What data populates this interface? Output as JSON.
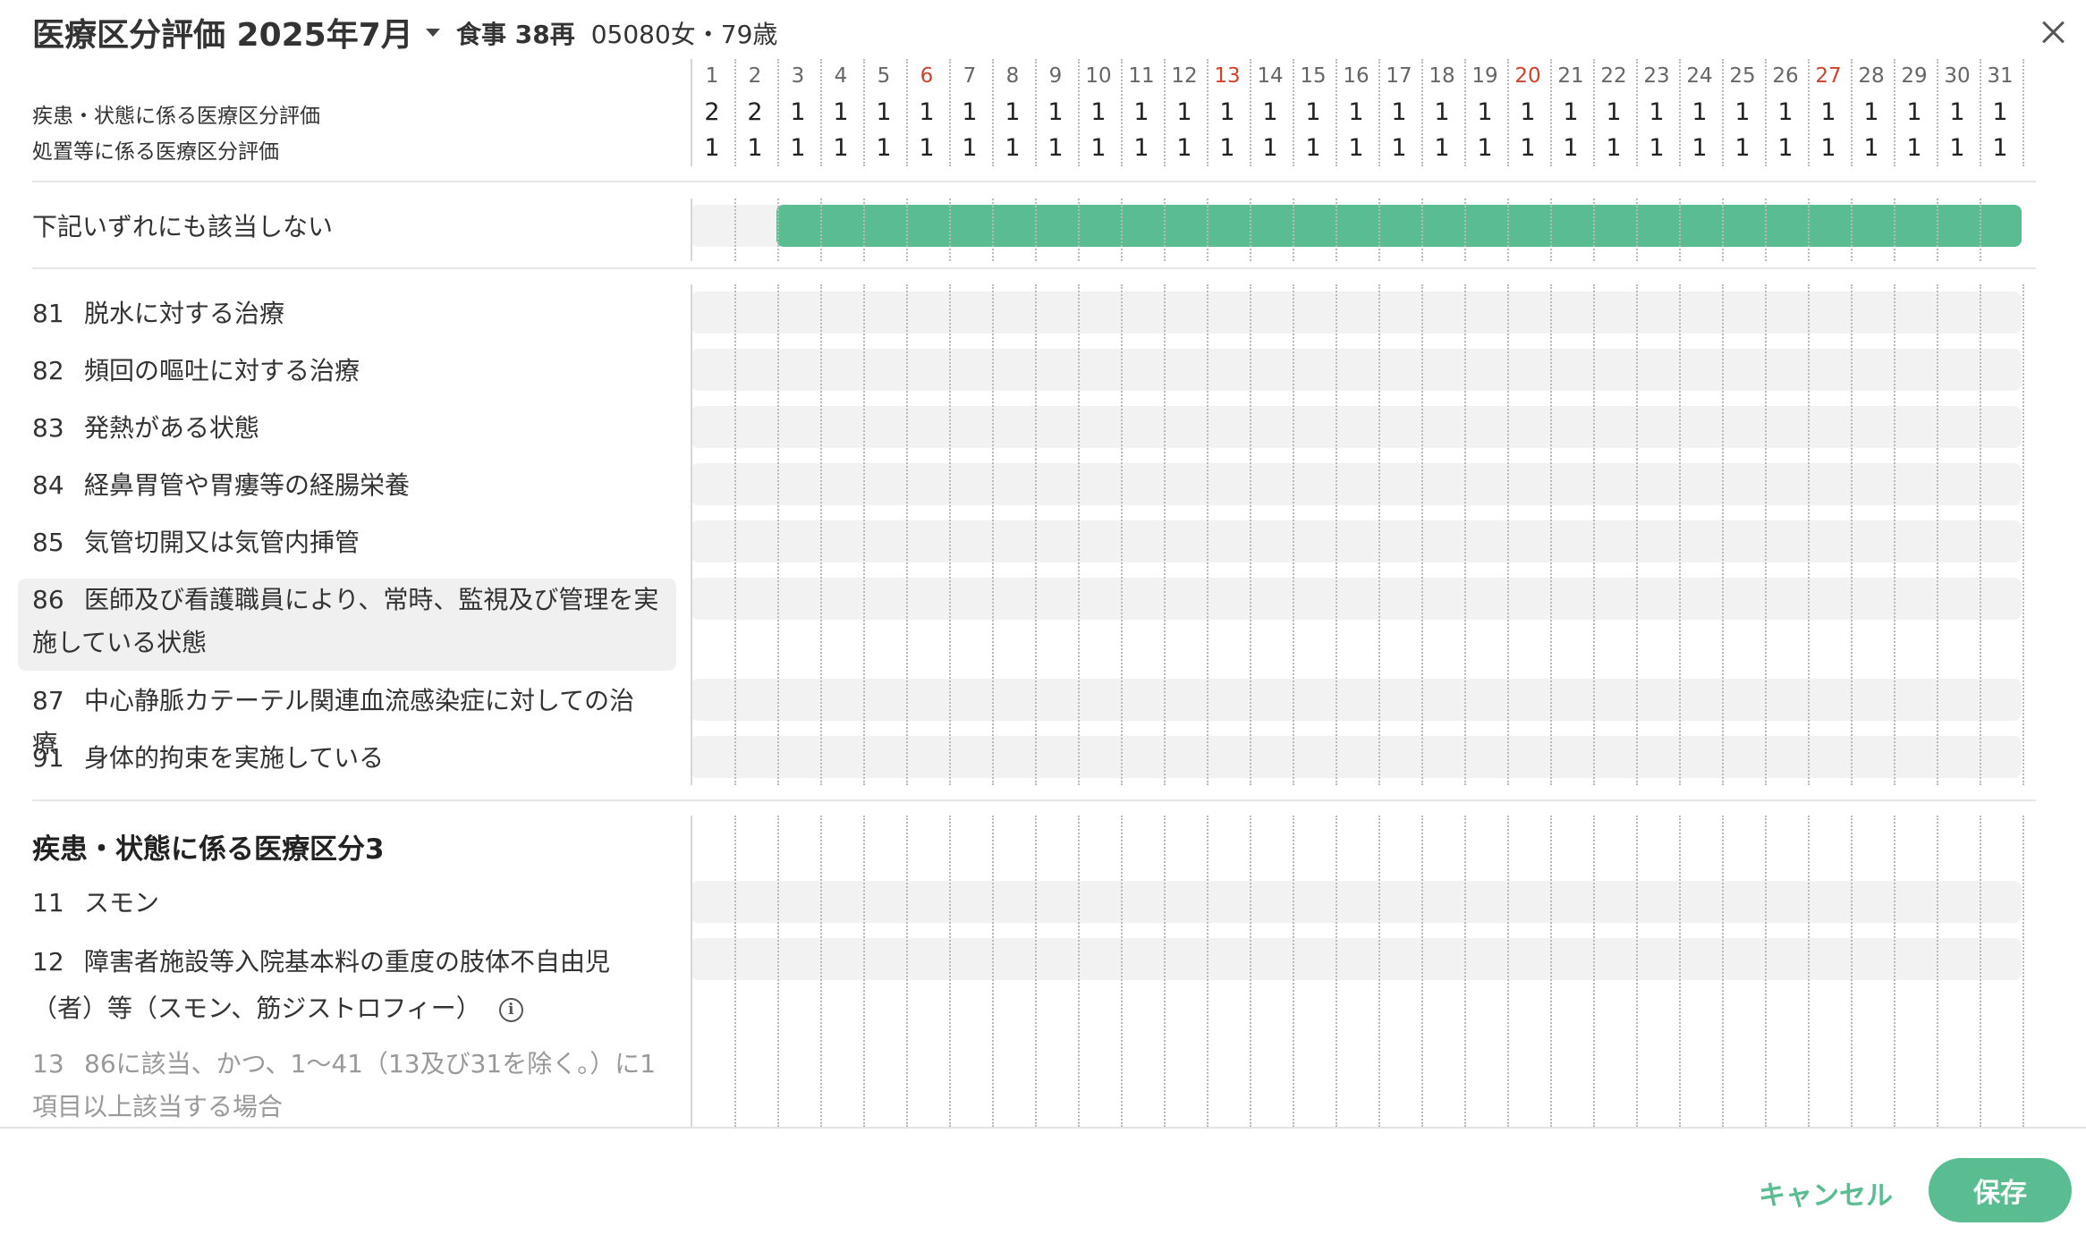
{
  "header": {
    "title": "医療区分評価 2025年7月",
    "meal_label": "食事 38再",
    "patient_info": "05080女・79歳"
  },
  "score_labels": {
    "disease": "疾患・状態に係る医療区分評価",
    "treatment": "処置等に係る医療区分評価"
  },
  "days": [
    {
      "d": "1",
      "disease": "2",
      "treatment": "1",
      "sunday": false
    },
    {
      "d": "2",
      "disease": "2",
      "treatment": "1",
      "sunday": false
    },
    {
      "d": "3",
      "disease": "1",
      "treatment": "1",
      "sunday": false
    },
    {
      "d": "4",
      "disease": "1",
      "treatment": "1",
      "sunday": false
    },
    {
      "d": "5",
      "disease": "1",
      "treatment": "1",
      "sunday": false
    },
    {
      "d": "6",
      "disease": "1",
      "treatment": "1",
      "sunday": true
    },
    {
      "d": "7",
      "disease": "1",
      "treatment": "1",
      "sunday": false
    },
    {
      "d": "8",
      "disease": "1",
      "treatment": "1",
      "sunday": false
    },
    {
      "d": "9",
      "disease": "1",
      "treatment": "1",
      "sunday": false
    },
    {
      "d": "10",
      "disease": "1",
      "treatment": "1",
      "sunday": false
    },
    {
      "d": "11",
      "disease": "1",
      "treatment": "1",
      "sunday": false
    },
    {
      "d": "12",
      "disease": "1",
      "treatment": "1",
      "sunday": false
    },
    {
      "d": "13",
      "disease": "1",
      "treatment": "1",
      "sunday": true
    },
    {
      "d": "14",
      "disease": "1",
      "treatment": "1",
      "sunday": false
    },
    {
      "d": "15",
      "disease": "1",
      "treatment": "1",
      "sunday": false
    },
    {
      "d": "16",
      "disease": "1",
      "treatment": "1",
      "sunday": false
    },
    {
      "d": "17",
      "disease": "1",
      "treatment": "1",
      "sunday": false
    },
    {
      "d": "18",
      "disease": "1",
      "treatment": "1",
      "sunday": false
    },
    {
      "d": "19",
      "disease": "1",
      "treatment": "1",
      "sunday": false
    },
    {
      "d": "20",
      "disease": "1",
      "treatment": "1",
      "sunday": true
    },
    {
      "d": "21",
      "disease": "1",
      "treatment": "1",
      "sunday": false
    },
    {
      "d": "22",
      "disease": "1",
      "treatment": "1",
      "sunday": false
    },
    {
      "d": "23",
      "disease": "1",
      "treatment": "1",
      "sunday": false
    },
    {
      "d": "24",
      "disease": "1",
      "treatment": "1",
      "sunday": false
    },
    {
      "d": "25",
      "disease": "1",
      "treatment": "1",
      "sunday": false
    },
    {
      "d": "26",
      "disease": "1",
      "treatment": "1",
      "sunday": false
    },
    {
      "d": "27",
      "disease": "1",
      "treatment": "1",
      "sunday": true
    },
    {
      "d": "28",
      "disease": "1",
      "treatment": "1",
      "sunday": false
    },
    {
      "d": "29",
      "disease": "1",
      "treatment": "1",
      "sunday": false
    },
    {
      "d": "30",
      "disease": "1",
      "treatment": "1",
      "sunday": false
    },
    {
      "d": "31",
      "disease": "1",
      "treatment": "1",
      "sunday": false
    }
  ],
  "none_row": {
    "label": "下記いずれにも該当しない",
    "active_from_day": 3,
    "active_to_day": 31
  },
  "rows": [
    {
      "code": "81",
      "text": "脱水に対する治療"
    },
    {
      "code": "82",
      "text": "頻回の嘔吐に対する治療"
    },
    {
      "code": "83",
      "text": "発熱がある状態"
    },
    {
      "code": "84",
      "text": "経鼻胃管や胃瘻等の経腸栄養"
    },
    {
      "code": "85",
      "text": "気管切開又は気管内挿管"
    },
    {
      "code": "86",
      "text": "医師及び看護職員により、常時、監視及び管理を実施している状態"
    },
    {
      "code": "87",
      "text": "中心静脈カテーテル関連血流感染症に対しての治療"
    },
    {
      "code": "91",
      "text": "身体的拘束を実施している"
    }
  ],
  "section": {
    "title": "疾患・状態に係る医療区分3",
    "rows": [
      {
        "code": "11",
        "text": "スモン"
      },
      {
        "code": "12",
        "text": "障害者施設等入院基本料の重度の肢体不自由児（者）等（スモン、筋ジストロフィー）"
      },
      {
        "code": "13",
        "text": "86に該当、かつ、1〜41（13及び31を除く。）に1項目以上該当する場合"
      }
    ]
  },
  "footer": {
    "cancel": "キャンセル",
    "save": "保存"
  },
  "colors": {
    "accent": "#59bd91",
    "sunday": "#d0422a",
    "track": "#f2f2f2"
  },
  "icons": {
    "dropdown": "chevron-down-icon",
    "close": "close-icon",
    "info": "info-icon"
  }
}
